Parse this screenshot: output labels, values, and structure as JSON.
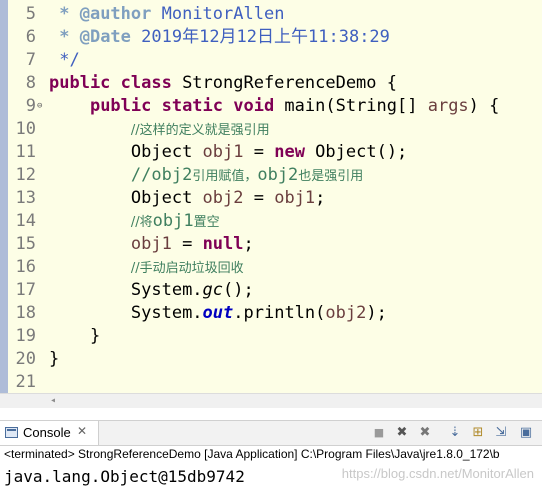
{
  "editor": {
    "line_numbers": [
      "5",
      "6",
      "7",
      "8",
      "9",
      "10",
      "11",
      "12",
      "13",
      "14",
      "15",
      "16",
      "17",
      "18",
      "19",
      "20",
      "21"
    ],
    "lines": {
      "l5_tag": "* @author",
      "l5_text": " MonitorAllen",
      "l6_tag": "* @Date",
      "l6_text": " 2019年12月12日上午11:38:29",
      "l7": "*/",
      "l8_kw": "public class",
      "l8_rest": " StrongReferenceDemo {",
      "l9_kw": "public static void",
      "l9_rest1": " main(String[] ",
      "l9_param": "args",
      "l9_rest2": ") {",
      "l10_cmt": "//这样的定义就是强引用",
      "l11_type": "Object ",
      "l11_var": "obj1",
      "l11_eq": " = ",
      "l11_new": "new",
      "l11_rest": " Object();",
      "l12_cmt1": "//",
      "l12_obj2a": "obj2",
      "l12_mid": "引用赋值，",
      "l12_obj2b": "obj2",
      "l12_end": "也是强引用",
      "l13_type": "Object ",
      "l13_var": "obj2",
      "l13_eq": " = ",
      "l13_var2": "obj1",
      "l13_end": ";",
      "l14_cmt1": "//将",
      "l14_obj1": "obj1",
      "l14_end": "置空",
      "l15_var": "obj1",
      "l15_eq": " = ",
      "l15_null": "null",
      "l15_end": ";",
      "l16_cmt": "//手动启动垃圾回收",
      "l17_a": "System.",
      "l17_gc": "gc",
      "l17_b": "();",
      "l18_a": "System.",
      "l18_out": "out",
      "l18_b": ".println(",
      "l18_var": "obj2",
      "l18_c": ");",
      "l19": "}",
      "l20": "}"
    }
  },
  "console": {
    "tab_label": "Console",
    "close_glyph": "✕",
    "status": "<terminated> StrongReferenceDemo [Java Application] C:\\Program Files\\Java\\jre1.8.0_172\\b",
    "output": "java.lang.Object@15db9742"
  },
  "watermark": "https://blog.csdn.net/MonitorAllen",
  "icons": {
    "terminate": "■",
    "remove": "✖",
    "remove_all": "✖",
    "scroll_lock": "⇣",
    "pin": "⊞",
    "word_wrap": "⇲",
    "open_console": "▣",
    "fold": "⊖",
    "scroll_left": "◂"
  },
  "colors": {
    "editor_bg": "#fdfee6",
    "keyword": "#7f0055",
    "javadoc": "#3f5fbf",
    "comment": "#3f7f5f",
    "static_field": "#0000c0"
  }
}
